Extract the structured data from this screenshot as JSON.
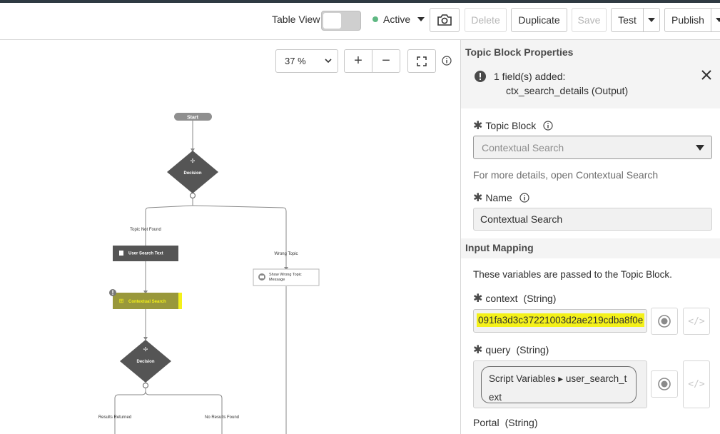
{
  "toolbar": {
    "table_view_label": "Table View",
    "table_view_on": false,
    "status_label": "Active",
    "status_color": "#5fb883",
    "camera_icon": "camera-icon",
    "delete_label": "Delete",
    "duplicate_label": "Duplicate",
    "save_label": "Save",
    "test_label": "Test",
    "publish_label": "Publish"
  },
  "canvas": {
    "zoom_value": "37 %",
    "zoom_in_label": "+",
    "zoom_out_label": "−",
    "nodes": {
      "start": "Start",
      "decision1": "Decision",
      "branch_not_found": "Topic Not Found",
      "branch_wrong": "Wrong Topic",
      "user_search_text": "User Search Text",
      "show_wrong_topic_1": "Show Wrong Topic",
      "show_wrong_topic_2": "Message",
      "contextual_search": "Contextual Search",
      "decision2": "Decision",
      "branch_results": "Results Returned",
      "branch_no_results": "No Results Found"
    },
    "highlight_color": "#f4f11a"
  },
  "panel": {
    "title": "Topic Block Properties",
    "alert_line1": "1 field(s) added:",
    "alert_line2": "ctx_search_details (Output)",
    "topic_block_label": "Topic Block",
    "topic_block_value": "Contextual Search",
    "more_details_prefix": "For more details, open",
    "more_details_link": "Contextual Search",
    "name_label": "Name",
    "name_value": "Contextual Search",
    "input_mapping_title": "Input Mapping",
    "input_mapping_desc": "These variables are passed to the Topic Block.",
    "context_label": "context",
    "context_type": "(String)",
    "context_value": "091fa3d3c37221003d2ae219cdba8f0e",
    "query_label": "query",
    "query_type": "(String)",
    "query_pill_line1": "Script Variables ▸ user_search_t",
    "query_pill_line2": "ext",
    "portal_label": "Portal",
    "portal_type": "(String)",
    "code_glyph": "</>"
  }
}
